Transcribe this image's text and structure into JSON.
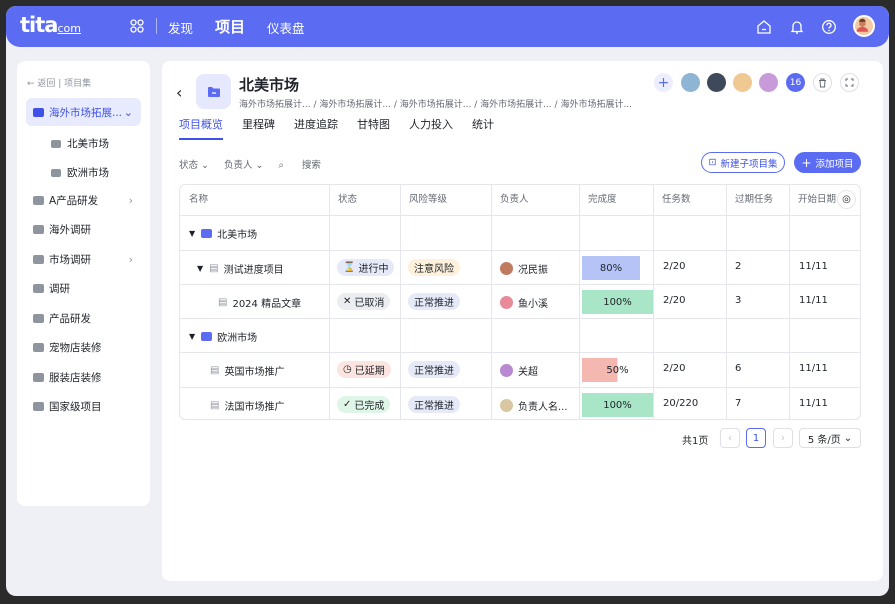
{
  "topbar": {
    "logo": "tita",
    "logo_suffix": "com",
    "nav": [
      "发现",
      "项目",
      "仪表盘"
    ],
    "active_nav": "项目"
  },
  "sidebar": {
    "back": "← 返回 | 项目集",
    "items": [
      {
        "label": "海外市场拓展...",
        "active": true
      },
      {
        "label": "A产品研发"
      },
      {
        "label": "海外调研"
      },
      {
        "label": "市场调研"
      },
      {
        "label": "调研"
      },
      {
        "label": "产品研发"
      },
      {
        "label": "宠物店装修"
      },
      {
        "label": "服装店装修"
      },
      {
        "label": "国家级项目"
      }
    ],
    "sub_items": [
      "北美市场",
      "欧洲市场"
    ]
  },
  "header": {
    "title": "北美市场",
    "breadcrumbs": [
      "海外市场拓展计...",
      "/ 海外市场拓展计...",
      "/ 海外市场拓展计...",
      "/ 海外市场拓展计...",
      "/ 海外市场拓展计..."
    ],
    "member_count": "16"
  },
  "tabs": [
    "项目概览",
    "里程碑",
    "进度追踪",
    "甘特图",
    "人力投入",
    "统计"
  ],
  "filters": {
    "status": "状态 ⌄",
    "owner": "负责人 ⌄",
    "search": "搜索"
  },
  "buttons": {
    "new_sub": "新建子项目集",
    "add_project": "添加项目"
  },
  "table": {
    "columns": [
      "名称",
      "状态",
      "风险等级",
      "负责人",
      "完成度",
      "任务数",
      "过期任务",
      "开始日期"
    ],
    "groups": [
      {
        "name": "北美市场",
        "rows": [
          {
            "name": "测试进度项目",
            "status": "进行中",
            "risk": "注意风险",
            "owner": "况民振",
            "progress": "80%",
            "tasks": "2/20",
            "overdue": "2",
            "start": "11/11"
          },
          {
            "name": "2024 精品文章",
            "status": "已取消",
            "risk": "正常推进",
            "owner": "鱼小溪",
            "progress": "100%",
            "tasks": "2/20",
            "overdue": "3",
            "start": "11/11"
          }
        ]
      },
      {
        "name": "欧洲市场",
        "rows": [
          {
            "name": "英国市场推广",
            "status": "已延期",
            "risk": "正常推进",
            "owner": "关超",
            "progress": "50%",
            "tasks": "2/20",
            "overdue": "6",
            "start": "11/11"
          },
          {
            "name": "法国市场推广",
            "status": "已完成",
            "risk": "正常推进",
            "owner": "负责人名...",
            "progress": "100%",
            "tasks": "20/220",
            "overdue": "7",
            "start": "11/11"
          }
        ]
      }
    ]
  },
  "pagination": {
    "total": "共1页",
    "page": "1",
    "size": "5 条/页"
  },
  "colors": {
    "accent": "#5b6cf2",
    "progress_blue": "#b5c3f7",
    "progress_green": "#a8e6c7",
    "progress_red": "#f4b8b0"
  }
}
